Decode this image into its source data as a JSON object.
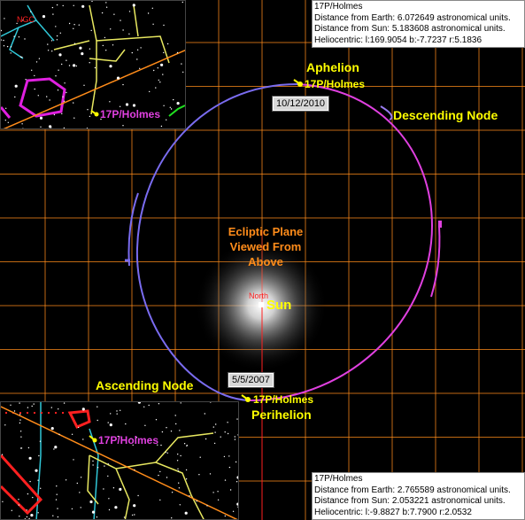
{
  "colors": {
    "grid": "#ff8c1a",
    "orbit_above": "#e040e0",
    "orbit_below": "#7a6cf0",
    "label_yellow": "#ffff00",
    "label_orange": "#ff8c1a",
    "north_red": "#ff2020"
  },
  "info_top": {
    "name": "17P/Holmes",
    "earth_line": "Distance from Earth: 6.072649  astronomical units.",
    "sun_line": "Distance from Sun:  5.183608  astronomical units.",
    "helio_line": "Heliocentric: l:169.9054 b:-7.7237  r:5.1836"
  },
  "info_bottom": {
    "name": "17P/Holmes",
    "earth_line": "Distance from Earth: 2.765589  astronomical units.",
    "sun_line": "Distance from Sun:  2.053221  astronomical units.",
    "helio_line": "Heliocentric: l:-9.8827 b:7.7900  r:2.0532"
  },
  "labels": {
    "aphelion": "Aphelion",
    "perihelion": "Perihelion",
    "descending_node": "Descending Node",
    "ascending_node": "Ascending Node",
    "plane_line1": "Ecliptic Plane",
    "plane_line2": "Viewed From Above",
    "sun": "Sun",
    "north": "North",
    "comet_aphelion": "17P/Holmes",
    "comet_perihelion": "17P/Holmes",
    "comet_starfield_top": "17P/Holmes",
    "comet_starfield_bottom": "17P/Holmes",
    "date_aphelion": "10/12/2010",
    "date_perihelion": "5/5/2007",
    "star_top_tag": "NGC"
  },
  "icons": {
    "comet": "comet-icon",
    "sun": "sun-glow-icon"
  }
}
